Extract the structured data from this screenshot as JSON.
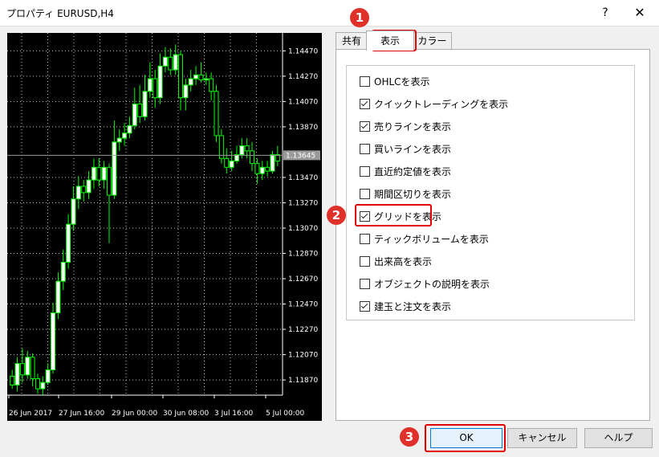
{
  "window": {
    "title": "プロパティ EURUSD,H4",
    "help_label": "?",
    "close_label": "✕"
  },
  "tabs": [
    {
      "label": "共有",
      "active": false
    },
    {
      "label": "表示",
      "active": true
    },
    {
      "label": "カラー",
      "active": false
    }
  ],
  "options": [
    {
      "label": "OHLCを表示",
      "checked": false
    },
    {
      "label": "クイックトレーディングを表示",
      "checked": true
    },
    {
      "label": "売りラインを表示",
      "checked": true
    },
    {
      "label": "買いラインを表示",
      "checked": false
    },
    {
      "label": "直近約定値を表示",
      "checked": false
    },
    {
      "label": "期間区切りを表示",
      "checked": false
    },
    {
      "label": "グリッドを表示",
      "checked": true
    },
    {
      "label": "ティックボリュームを表示",
      "checked": false
    },
    {
      "label": "出来高を表示",
      "checked": false
    },
    {
      "label": "オブジェクトの説明を表示",
      "checked": false
    },
    {
      "label": "建玉と注文を表示",
      "checked": true
    }
  ],
  "buttons": {
    "ok": "OK",
    "cancel": "キャンセル",
    "help": "ヘルプ"
  },
  "badges": [
    "1",
    "2",
    "3"
  ],
  "colors": {
    "candle_up": "#ffffff",
    "candle_down": "#000000",
    "wick": "#00ff00",
    "grid": "#bfbfbf",
    "annotation": "#e00000"
  },
  "chart_data": {
    "type": "candlestick",
    "symbol": "EURUSD",
    "timeframe": "H4",
    "y_ticks": [
      "1.14470",
      "1.14270",
      "1.14070",
      "1.13870",
      "1.13645",
      "1.13470",
      "1.13270",
      "1.13070",
      "1.12870",
      "1.12670",
      "1.12470",
      "1.12270",
      "1.12070",
      "1.11870"
    ],
    "current_price": "1.13645",
    "x_ticks": [
      "26 Jun 2017",
      "27 Jun 16:00",
      "29 Jun 00:00",
      "30 Jun 08:00",
      "3 Jul 16:00",
      "5 Jul 00:00"
    ],
    "ylim": [
      1.1175,
      1.1458
    ],
    "grid": true,
    "candles": [
      [
        1.119,
        1.1183,
        1.1195,
        1.118
      ],
      [
        1.1183,
        1.12,
        1.1205,
        1.1178
      ],
      [
        1.12,
        1.1191,
        1.1212,
        1.1185
      ],
      [
        1.1191,
        1.1205,
        1.121,
        1.1188
      ],
      [
        1.1205,
        1.1188,
        1.1208,
        1.1182
      ],
      [
        1.1188,
        1.118,
        1.1192,
        1.1176
      ],
      [
        1.118,
        1.1185,
        1.119,
        1.1175
      ],
      [
        1.1185,
        1.1195,
        1.12,
        1.1183
      ],
      [
        1.1195,
        1.124,
        1.1248,
        1.1192
      ],
      [
        1.124,
        1.1265,
        1.1272,
        1.1235
      ],
      [
        1.1265,
        1.128,
        1.129,
        1.1258
      ],
      [
        1.128,
        1.131,
        1.1318,
        1.1275
      ],
      [
        1.131,
        1.133,
        1.134,
        1.1305
      ],
      [
        1.133,
        1.134,
        1.1348,
        1.1322
      ],
      [
        1.134,
        1.1335,
        1.1345,
        1.1328
      ],
      [
        1.1335,
        1.1345,
        1.1352,
        1.133
      ],
      [
        1.1345,
        1.1355,
        1.1362,
        1.1338
      ],
      [
        1.1355,
        1.1345,
        1.1362,
        1.134
      ],
      [
        1.1345,
        1.1355,
        1.136,
        1.1338
      ],
      [
        1.1355,
        1.1333,
        1.1358,
        1.1295
      ],
      [
        1.1333,
        1.1375,
        1.1392,
        1.133
      ],
      [
        1.1375,
        1.1378,
        1.1385,
        1.1368
      ],
      [
        1.1378,
        1.1382,
        1.139,
        1.1372
      ],
      [
        1.1382,
        1.1388,
        1.1395,
        1.1378
      ],
      [
        1.1388,
        1.1405,
        1.1418,
        1.1385
      ],
      [
        1.1405,
        1.1395,
        1.142,
        1.139
      ],
      [
        1.1395,
        1.1415,
        1.1428,
        1.1392
      ],
      [
        1.1415,
        1.1425,
        1.1438,
        1.141
      ],
      [
        1.1425,
        1.141,
        1.1432,
        1.1402
      ],
      [
        1.141,
        1.1435,
        1.1445,
        1.1405
      ],
      [
        1.1435,
        1.1442,
        1.145,
        1.143
      ],
      [
        1.1442,
        1.1432,
        1.1449,
        1.1428
      ],
      [
        1.1432,
        1.1444,
        1.1452,
        1.1428
      ],
      [
        1.1444,
        1.141,
        1.1447,
        1.14
      ],
      [
        1.141,
        1.142,
        1.1425,
        1.14
      ],
      [
        1.142,
        1.1425,
        1.1432,
        1.1415
      ],
      [
        1.1425,
        1.1428,
        1.1435,
        1.142
      ],
      [
        1.1428,
        1.1424,
        1.1438,
        1.1422
      ],
      [
        1.1424,
        1.1425,
        1.143,
        1.142
      ],
      [
        1.1425,
        1.1415,
        1.143,
        1.1408
      ],
      [
        1.1415,
        1.138,
        1.142,
        1.1375
      ],
      [
        1.138,
        1.1362,
        1.1385,
        1.1358
      ],
      [
        1.1362,
        1.1355,
        1.137,
        1.135
      ],
      [
        1.1355,
        1.136,
        1.1368,
        1.1352
      ],
      [
        1.136,
        1.1365,
        1.1372,
        1.1358
      ],
      [
        1.1365,
        1.1372,
        1.1378,
        1.1362
      ],
      [
        1.1372,
        1.1368,
        1.1378,
        1.1362
      ],
      [
        1.1368,
        1.1358,
        1.1375,
        1.1352
      ],
      [
        1.1358,
        1.135,
        1.1362,
        1.1342
      ],
      [
        1.135,
        1.1355,
        1.136,
        1.1345
      ],
      [
        1.1355,
        1.1352,
        1.136,
        1.1348
      ],
      [
        1.1352,
        1.1365,
        1.1368,
        1.135
      ],
      [
        1.1365,
        1.136,
        1.1372,
        1.1356
      ]
    ]
  }
}
